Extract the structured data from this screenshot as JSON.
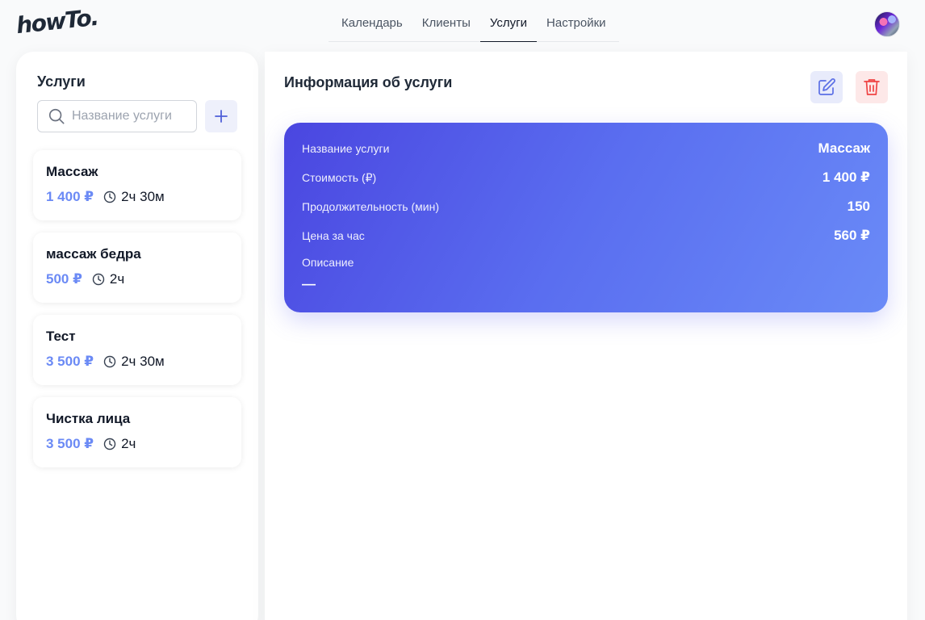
{
  "header": {
    "logo": "howTo.",
    "tabs": [
      "Календарь",
      "Клиенты",
      "Услуги",
      "Настройки"
    ],
    "active_tab": "Услуги"
  },
  "sidebar": {
    "title": "Услуги",
    "search": {
      "placeholder": "Название услуги",
      "value": ""
    },
    "services": [
      {
        "name": "Массаж",
        "price": "1 400 ₽",
        "duration": "2ч 30м"
      },
      {
        "name": "массаж бедра",
        "price": "500 ₽",
        "duration": "2ч"
      },
      {
        "name": "Тест",
        "price": "3 500 ₽",
        "duration": "2ч 30м"
      },
      {
        "name": "Чистка лица",
        "price": "3 500 ₽",
        "duration": "2ч"
      }
    ]
  },
  "details": {
    "title": "Информация об услуги",
    "rows": [
      {
        "label": "Название услуги",
        "value": "Массаж"
      },
      {
        "label": "Стоимость (₽)",
        "value": "1 400 ₽"
      },
      {
        "label": "Продолжительность (мин)",
        "value": "150"
      },
      {
        "label": "Цена за час",
        "value": "560 ₽"
      }
    ],
    "description_label": "Описание",
    "description_value": "—"
  },
  "icons": {
    "search": "search-icon",
    "add": "plus-icon",
    "clock": "clock-icon",
    "edit": "edit-icon",
    "delete": "trash-icon"
  },
  "colors": {
    "accent": "#6b8af5",
    "card_gradient_start": "#4a46e0",
    "card_gradient_end": "#6a8bf7",
    "delete": "#ef4444",
    "edit": "#5b6fe6"
  }
}
